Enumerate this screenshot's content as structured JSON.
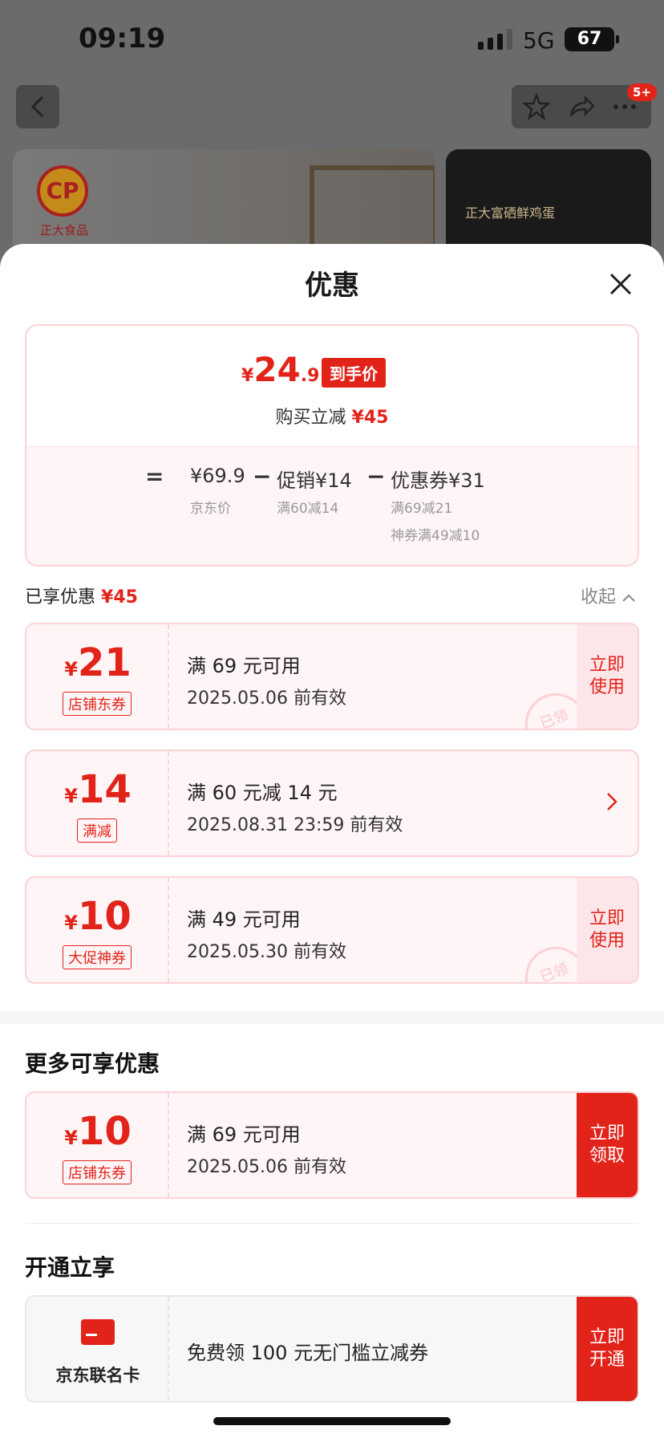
{
  "status": {
    "time": "09:19",
    "network": "5G",
    "battery": "67"
  },
  "topbar": {
    "badge": "5+"
  },
  "banner": {
    "logo": "CP",
    "brand": "正大食品",
    "right_text": "正大富硒鲜鸡蛋"
  },
  "sheet": {
    "title": "优惠"
  },
  "price": {
    "currency": "¥",
    "int": "24",
    "dec": ".9",
    "tag": "到手价",
    "reduce_label": "购买立减",
    "reduce_value": "¥45",
    "eq": "=",
    "minus": "−",
    "jd_price": "¥69.9",
    "jd_price_label": "京东价",
    "promo": "促销¥14",
    "promo_label": "满60减14",
    "coupon": "优惠券¥31",
    "coupon_label1": "满69减21",
    "coupon_label2": "神券满49减10"
  },
  "enjoyed": {
    "label": "已享优惠",
    "value": "¥45",
    "collapse": "收起"
  },
  "coupons": [
    {
      "cur": "¥",
      "amount": "21",
      "tag": "店铺东券",
      "condition": "满 69 元可用",
      "expiry": "2025.05.06 前有效",
      "action": "立即使用",
      "stamp": "已领"
    },
    {
      "cur": "¥",
      "amount": "14",
      "tag": "满减",
      "condition": "满 60 元减 14 元",
      "expiry": "2025.08.31 23:59 前有效"
    },
    {
      "cur": "¥",
      "amount": "10",
      "tag": "大促神券",
      "condition": "满 49 元可用",
      "expiry": "2025.05.30 前有效",
      "action": "立即使用",
      "stamp": "已领"
    }
  ],
  "more": {
    "title": "更多可享优惠",
    "coupon": {
      "cur": "¥",
      "amount": "10",
      "tag": "店铺东券",
      "condition": "满 69 元可用",
      "expiry": "2025.05.06 前有效",
      "action": "立即领取"
    }
  },
  "open": {
    "title": "开通立享",
    "card_name": "京东联名卡",
    "desc": "免费领 100 元无门槛立减券",
    "action": "立即开通"
  },
  "colors": {
    "accent": "#e2231a",
    "soft": "#fff5f6",
    "border": "#fbd2d6"
  }
}
